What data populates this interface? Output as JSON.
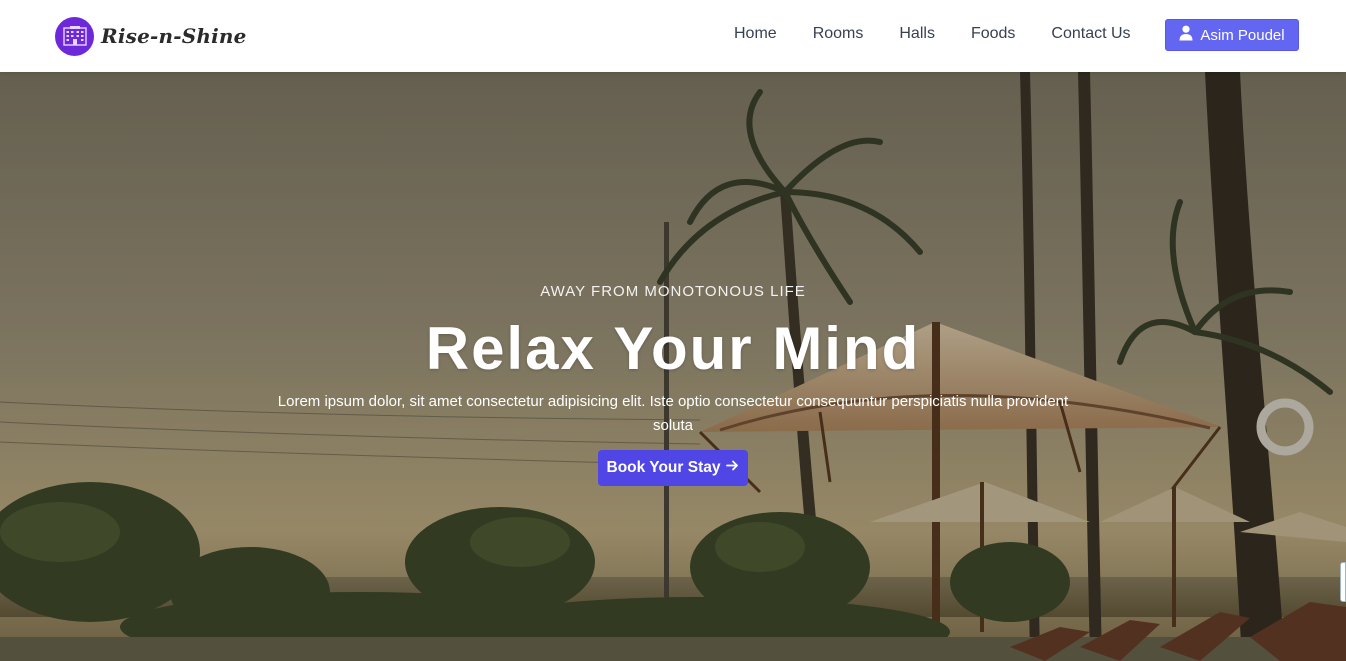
{
  "brand": {
    "name": "Rise-n-Shine",
    "logo_icon": "hotel-building-icon",
    "logo_color": "#6d28d9"
  },
  "nav": {
    "links": [
      {
        "label": "Home"
      },
      {
        "label": "Rooms"
      },
      {
        "label": "Halls"
      },
      {
        "label": "Foods"
      },
      {
        "label": "Contact Us"
      }
    ],
    "user": {
      "name": "Asim Poudel",
      "icon": "user-icon",
      "color": "#6366f1"
    }
  },
  "hero": {
    "kicker": "AWAY FROM MONOTONOUS LIFE",
    "title": "Relax Your Mind",
    "description": "Lorem ipsum dolor, sit amet consectetur adipisicing elit. Iste optio consectetur consequuntur perspiciatis nulla provident soluta",
    "cta_label": "Book Your Stay",
    "cta_icon": "arrow-right-icon",
    "cta_color": "#4f46e5",
    "background": "tropical-resort-beach-photo"
  }
}
